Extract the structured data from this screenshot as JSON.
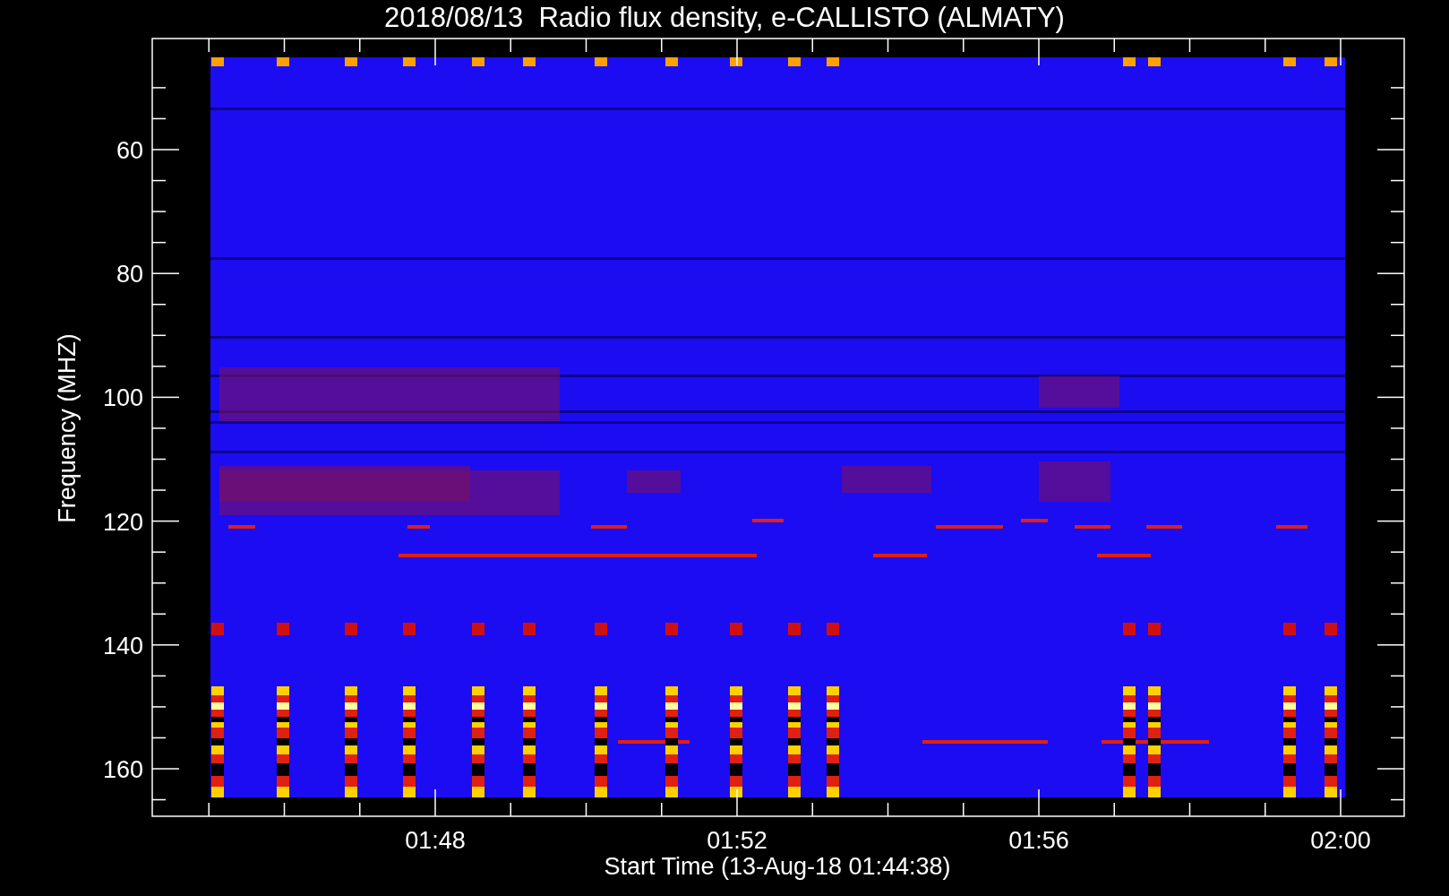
{
  "title": "2018/08/13  Radio flux density, e-CALLISTO (ALMATY)",
  "y_axis": {
    "label": "Frequency (MHZ)",
    "ticks": [
      "60",
      "80",
      "100",
      "120",
      "140",
      "160"
    ]
  },
  "x_axis": {
    "label": "Start Time (13-Aug-18 01:44:38)",
    "ticks": [
      "01:48",
      "01:52",
      "01:56",
      "02:00"
    ]
  }
}
